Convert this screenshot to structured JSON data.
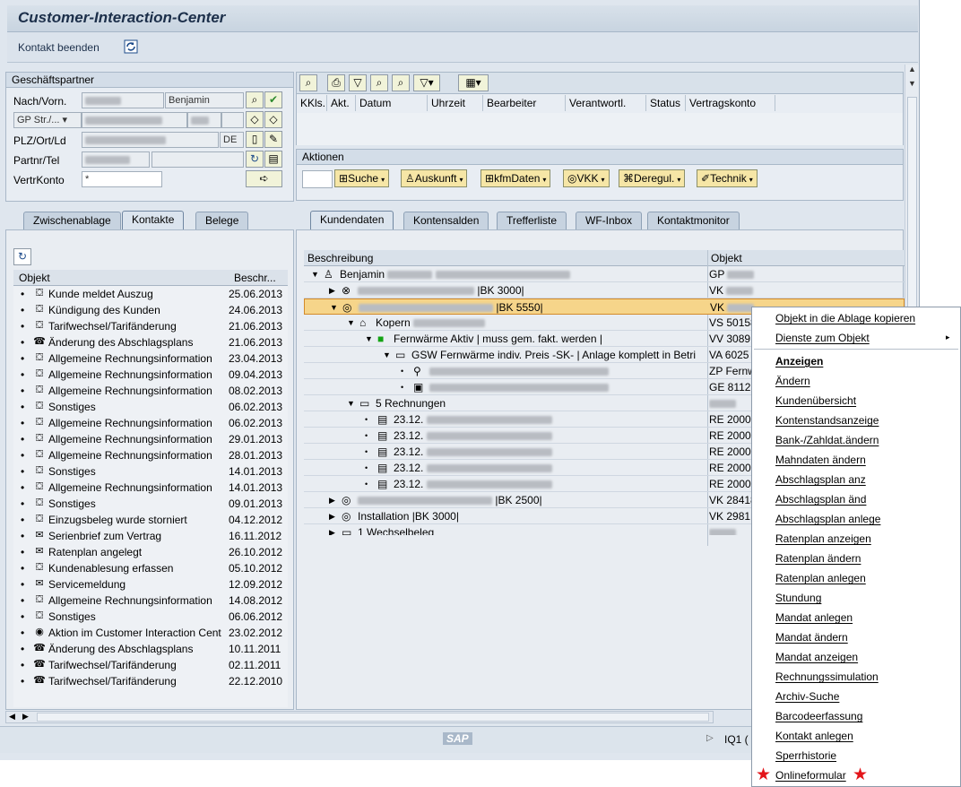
{
  "window": {
    "title": "Customer-Interaction-Center"
  },
  "appbar": {
    "end_contact": "Kontakt beenden"
  },
  "partner": {
    "title": "Geschäftspartner",
    "labels": {
      "name": "Nach/Vorn.",
      "street": "GP Str./...",
      "city": "PLZ/Ort/Ld",
      "tel": "Partnr/Tel",
      "contract": "VertrKonto"
    },
    "firstname": "Benjamin",
    "country": "DE",
    "contract_value": "*"
  },
  "top_table": {
    "headers": [
      "KKls.",
      "Akt.",
      "Datum",
      "Uhrzeit",
      "Bearbeiter",
      "Verantwortl.",
      "Status",
      "Vertragskonto"
    ]
  },
  "actions": {
    "title": "Aktionen",
    "buttons": [
      "Suche",
      "Auskunft",
      "kfmDaten",
      "VKK",
      "Deregul.",
      "Technik"
    ]
  },
  "left_tabs": [
    "Zwischenablage",
    "Kontakte",
    "Belege"
  ],
  "left_list": {
    "headers": [
      "Objekt",
      "Beschr..."
    ],
    "rows": [
      {
        "text": "Kunde meldet Auszug",
        "date": "25.06.2013",
        "icon": "document-icon"
      },
      {
        "text": "Kündigung des Kunden",
        "date": "24.06.2013",
        "icon": "document-icon"
      },
      {
        "text": "Tarifwechsel/Tarifänderung",
        "date": "21.06.2013",
        "icon": "document-icon"
      },
      {
        "text": "Änderung des Abschlagsplans",
        "date": "21.06.2013",
        "icon": "phone-icon"
      },
      {
        "text": "Allgemeine Rechnungsinformation",
        "date": "23.04.2013",
        "icon": "document-icon"
      },
      {
        "text": "Allgemeine Rechnungsinformation",
        "date": "09.04.2013",
        "icon": "document-icon"
      },
      {
        "text": "Allgemeine Rechnungsinformation",
        "date": "08.02.2013",
        "icon": "document-icon"
      },
      {
        "text": "Sonstiges",
        "date": "06.02.2013",
        "icon": "document-icon"
      },
      {
        "text": "Allgemeine Rechnungsinformation",
        "date": "06.02.2013",
        "icon": "document-icon"
      },
      {
        "text": "Allgemeine Rechnungsinformation",
        "date": "29.01.2013",
        "icon": "document-icon"
      },
      {
        "text": "Allgemeine Rechnungsinformation",
        "date": "28.01.2013",
        "icon": "document-icon"
      },
      {
        "text": "Sonstiges",
        "date": "14.01.2013",
        "icon": "document-icon"
      },
      {
        "text": "Allgemeine Rechnungsinformation",
        "date": "14.01.2013",
        "icon": "document-icon"
      },
      {
        "text": "Sonstiges",
        "date": "09.01.2013",
        "icon": "document-icon"
      },
      {
        "text": "Einzugsbeleg wurde storniert",
        "date": "04.12.2012",
        "icon": "document-icon"
      },
      {
        "text": "Serienbrief zum Vertrag",
        "date": "16.11.2012",
        "icon": "letter-icon"
      },
      {
        "text": "Ratenplan angelegt",
        "date": "26.10.2012",
        "icon": "mail-icon"
      },
      {
        "text": "Kundenablesung erfassen",
        "date": "05.10.2012",
        "icon": "document-icon"
      },
      {
        "text": "Servicemeldung",
        "date": "12.09.2012",
        "icon": "mail-icon"
      },
      {
        "text": "Allgemeine Rechnungsinformation",
        "date": "14.08.2012",
        "icon": "document-icon"
      },
      {
        "text": "Sonstiges",
        "date": "06.06.2012",
        "icon": "document-icon"
      },
      {
        "text": "Aktion im Customer Interaction Cent",
        "date": "23.02.2012",
        "icon": "globe-icon"
      },
      {
        "text": "Änderung des Abschlagsplans",
        "date": "10.11.2011",
        "icon": "phone-icon"
      },
      {
        "text": "Tarifwechsel/Tarifänderung",
        "date": "02.11.2011",
        "icon": "phone-icon"
      },
      {
        "text": "Tarifwechsel/Tarifänderung",
        "date": "22.12.2010",
        "icon": "phone-icon"
      }
    ]
  },
  "right_tabs": [
    "Kundendaten",
    "Kontensalden",
    "Trefferliste",
    "WF-Inbox",
    "Kontaktmonitor"
  ],
  "tree": {
    "headers": [
      "Beschreibung",
      "Objekt"
    ],
    "rows": [
      {
        "text": "Benjamin",
        "obj": "GP"
      },
      {
        "text": "|BK 3000|",
        "obj": "VK"
      },
      {
        "text": "|BK 5550|",
        "obj": "VK"
      },
      {
        "text": "Kopern",
        "obj": "VS 50158"
      },
      {
        "text": "Fernwärme Aktiv | muss gem. fakt. werden |",
        "obj": "VV 3089"
      },
      {
        "text": "GSW Fernwärme indiv. Preis -SK-  | Anlage komplett in Betri",
        "obj": "VA 6025"
      },
      {
        "text": "",
        "obj": "ZP Fernw"
      },
      {
        "text": "",
        "obj": "GE 81122"
      },
      {
        "text": "5 Rechnungen",
        "obj": ""
      },
      {
        "text": "23.12.",
        "obj": "RE 20000"
      },
      {
        "text": "23.12.",
        "obj": "RE 20000"
      },
      {
        "text": "23.12.",
        "obj": "RE 20000"
      },
      {
        "text": "23.12.",
        "obj": "RE 20000"
      },
      {
        "text": "23.12.",
        "obj": "RE 20000"
      },
      {
        "text": "|BK 2500|",
        "obj": "VK 28418"
      },
      {
        "text": "Installation |BK 3000|",
        "obj": "VK 2981"
      },
      {
        "text": "1 Wechselbeleg",
        "obj": ""
      }
    ]
  },
  "statusbar": {
    "logo": "SAP",
    "system": "IQ1 ("
  },
  "context_menu": {
    "items": [
      {
        "label": "Objekt in die Ablage kopieren"
      },
      {
        "label": "Dienste zum Objekt",
        "submenu": true
      },
      {
        "label": "Anzeigen",
        "bold": true
      },
      {
        "label": "Ändern"
      },
      {
        "label": "Kundenübersicht"
      },
      {
        "label": "Kontenstandsanzeige"
      },
      {
        "label": "Bank-/Zahldat.ändern"
      },
      {
        "label": "Mahndaten ändern"
      },
      {
        "label": "Abschlagsplan anz"
      },
      {
        "label": "Abschlagsplan änd"
      },
      {
        "label": "Abschlagsplan anlege"
      },
      {
        "label": "Ratenplan anzeigen"
      },
      {
        "label": "Ratenplan ändern"
      },
      {
        "label": "Ratenplan anlegen"
      },
      {
        "label": "Stundung"
      },
      {
        "label": "Mandat anlegen"
      },
      {
        "label": "Mandat ändern"
      },
      {
        "label": "Mandat anzeigen"
      },
      {
        "label": "Rechnungssimulation"
      },
      {
        "label": "Archiv-Suche"
      },
      {
        "label": "Barcodeerfassung"
      },
      {
        "label": "Kontakt anlegen"
      },
      {
        "label": "Sperrhistorie"
      },
      {
        "label": "Onlineformular",
        "highlight": true
      }
    ]
  },
  "colors": {
    "selection": "#f6d58a",
    "accent_star": "#e3151a",
    "button": "#f6e6a6"
  }
}
